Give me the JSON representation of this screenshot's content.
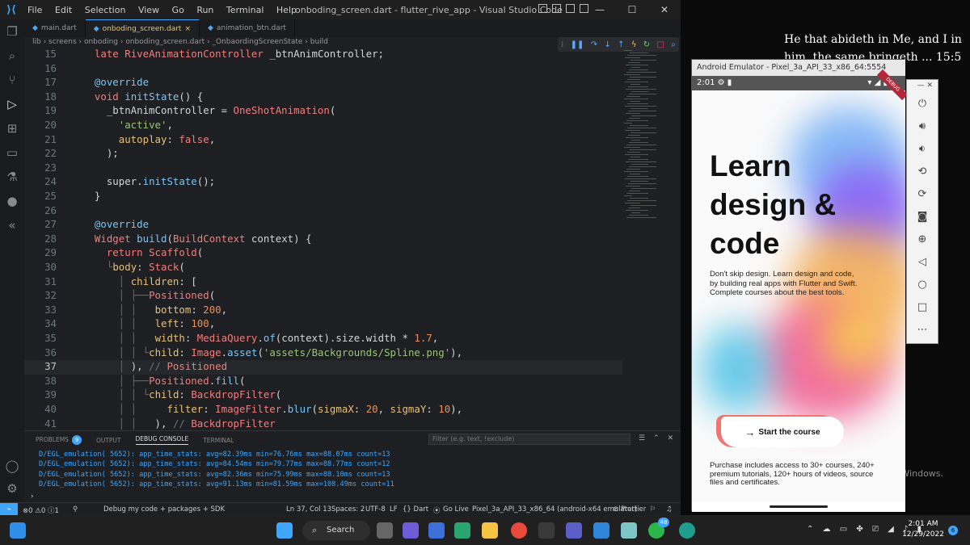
{
  "window": {
    "title": "onboding_screen.dart - flutter_rive_app - Visual Studio Code",
    "menu": [
      "File",
      "Edit",
      "Selection",
      "View",
      "Go",
      "Run",
      "Terminal",
      "Help"
    ]
  },
  "tabs": [
    {
      "label": "main.dart"
    },
    {
      "label": "onboding_screen.dart",
      "close": "×"
    },
    {
      "label": "animation_btn.dart"
    }
  ],
  "breadcrumb": "lib › screens › onboding › onboding_screen.dart › _OnbaordingScreenState › build",
  "editor": {
    "current_line": 37,
    "lines": [
      {
        "n": "15",
        "t": "  late RiveAnimationController _btnAnimController;"
      },
      {
        "n": "16",
        "t": ""
      },
      {
        "n": "17",
        "t": "  @override"
      },
      {
        "n": "18",
        "t": "  void initState() {"
      },
      {
        "n": "19",
        "t": "    _btnAnimController = OneShotAnimation("
      },
      {
        "n": "20",
        "t": "      'active',"
      },
      {
        "n": "21",
        "t": "      autoplay: false,"
      },
      {
        "n": "22",
        "t": "    );"
      },
      {
        "n": "23",
        "t": ""
      },
      {
        "n": "24",
        "t": "    super.initState();"
      },
      {
        "n": "25",
        "t": "  }"
      },
      {
        "n": "26",
        "t": ""
      },
      {
        "n": "27",
        "t": "  @override"
      },
      {
        "n": "28",
        "t": "  Widget build(BuildContext context) {"
      },
      {
        "n": "29",
        "t": "    return Scaffold("
      },
      {
        "n": "30",
        "t": "    └body: Stack("
      },
      {
        "n": "31",
        "t": "      │ children: ["
      },
      {
        "n": "32",
        "t": "      │ ├──Positioned("
      },
      {
        "n": "33",
        "t": "      │ │   bottom: 200,"
      },
      {
        "n": "34",
        "t": "      │ │   left: 100,"
      },
      {
        "n": "35",
        "t": "      │ │   width: MediaQuery.of(context).size.width * 1.7,"
      },
      {
        "n": "36",
        "t": "      │ │ └child: Image.asset('assets/Backgrounds/Spline.png'),"
      },
      {
        "n": "37",
        "t": "      │ ), // Positioned"
      },
      {
        "n": "38",
        "t": "      │ ├──Positioned.fill("
      },
      {
        "n": "39",
        "t": "      │ │ └child: BackdropFilter("
      },
      {
        "n": "40",
        "t": "      │ │     filter: ImageFilter.blur(sigmaX: 20, sigmaY: 10),"
      },
      {
        "n": "41",
        "t": "      │ │   ), // BackdropFilter"
      }
    ]
  },
  "panel": {
    "tabs": [
      "PROBLEMS",
      "OUTPUT",
      "DEBUG CONSOLE",
      "TERMINAL"
    ],
    "problems_badge": "9",
    "filter_placeholder": "Filter (e.g. text, !exclude)",
    "logs": [
      "D/EGL_emulation( 5652): app_time_stats: avg=82.39ms min=76.76ms max=88.07ms count=13",
      "D/EGL_emulation( 5652): app_time_stats: avg=84.54ms min=79.77ms max=88.77ms count=12",
      "D/EGL_emulation( 5652): app_time_stats: avg=82.36ms min=75.99ms max=88.10ms count=13",
      "D/EGL_emulation( 5652): app_time_stats: avg=91.13ms min=81.59ms max=108.49ms count=11"
    ]
  },
  "statusbar": {
    "problems": "⊗0 ⚠0 ⓘ1",
    "debug": "Debug my code + packages + SDK",
    "position": "Ln 37, Col 13",
    "spaces": "Spaces: 2",
    "encoding": "UTF-8",
    "eol": "LF",
    "language": "{} Dart",
    "golive": "Go Live",
    "device": "Pixel_3a_API_33_x86_64 (android-x64 emulator)",
    "prettier": "Prettier"
  },
  "desktop": {
    "verse": "He that abideth in Me, and I in him, the same bringeth ... 15:5",
    "activate": "Go to Settings to activate Windows."
  },
  "emulator": {
    "title": "Android Emulator - Pixel_3a_API_33_x86_64:5554",
    "time": "2:01",
    "ribbon": "DEBUG",
    "app": {
      "title": "Learn design & code",
      "description": "Don't skip design. Learn design and code, by building real apps with Flutter and Swift. Complete courses about the best tools.",
      "button": "Start the course",
      "footer": "Purchase includes access to 30+ courses, 240+ premium tutorials, 120+ hours of videos, source files and certificates."
    }
  },
  "taskbar": {
    "search": "Search",
    "whatsapp_badge": "48",
    "time": "2:01 AM",
    "date": "12/29/2022",
    "notifications": "6"
  }
}
